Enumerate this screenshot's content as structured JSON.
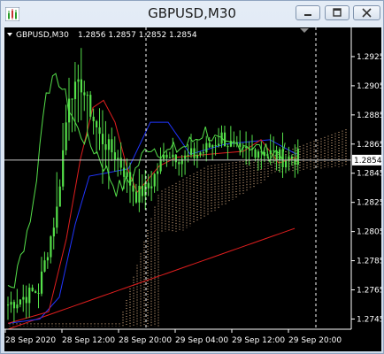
{
  "window": {
    "title": "GBPUSD,M30"
  },
  "header": {
    "symbol_label": "GBPUSD,M30",
    "ohlc": "1.2856 1.2857 1.2852 1.2854"
  },
  "chart_data": {
    "type": "candlestick",
    "symbol": "GBPUSD",
    "timeframe": "M30",
    "ylim": [
      1.2738,
      1.2945
    ],
    "y_ticks": [
      "1.2925",
      "1.2905",
      "1.2885",
      "1.2865",
      "1.2845",
      "1.2825",
      "1.2805",
      "1.2785",
      "1.2765",
      "1.2745"
    ],
    "x_ticks": [
      "28 Sep 2020",
      "28 Sep 12:00",
      "28 Sep 20:00",
      "29 Sep 04:00",
      "29 Sep 12:00",
      "29 Sep 20:00"
    ],
    "current_price": "1.2854",
    "colors": {
      "background": "#000000",
      "candles": "#55e04a",
      "ma_slow": "#e01e1e",
      "tenkan": "#e01e1e",
      "kijun": "#2035ff",
      "chikou": "#55e04a",
      "cloud": "#f0c090",
      "grid_separator": "#ffffff",
      "price_line": "#c8c8c8"
    },
    "indicators": [
      "Ichimoku Kinko Hyo",
      "Moving Average"
    ],
    "grid": false
  }
}
